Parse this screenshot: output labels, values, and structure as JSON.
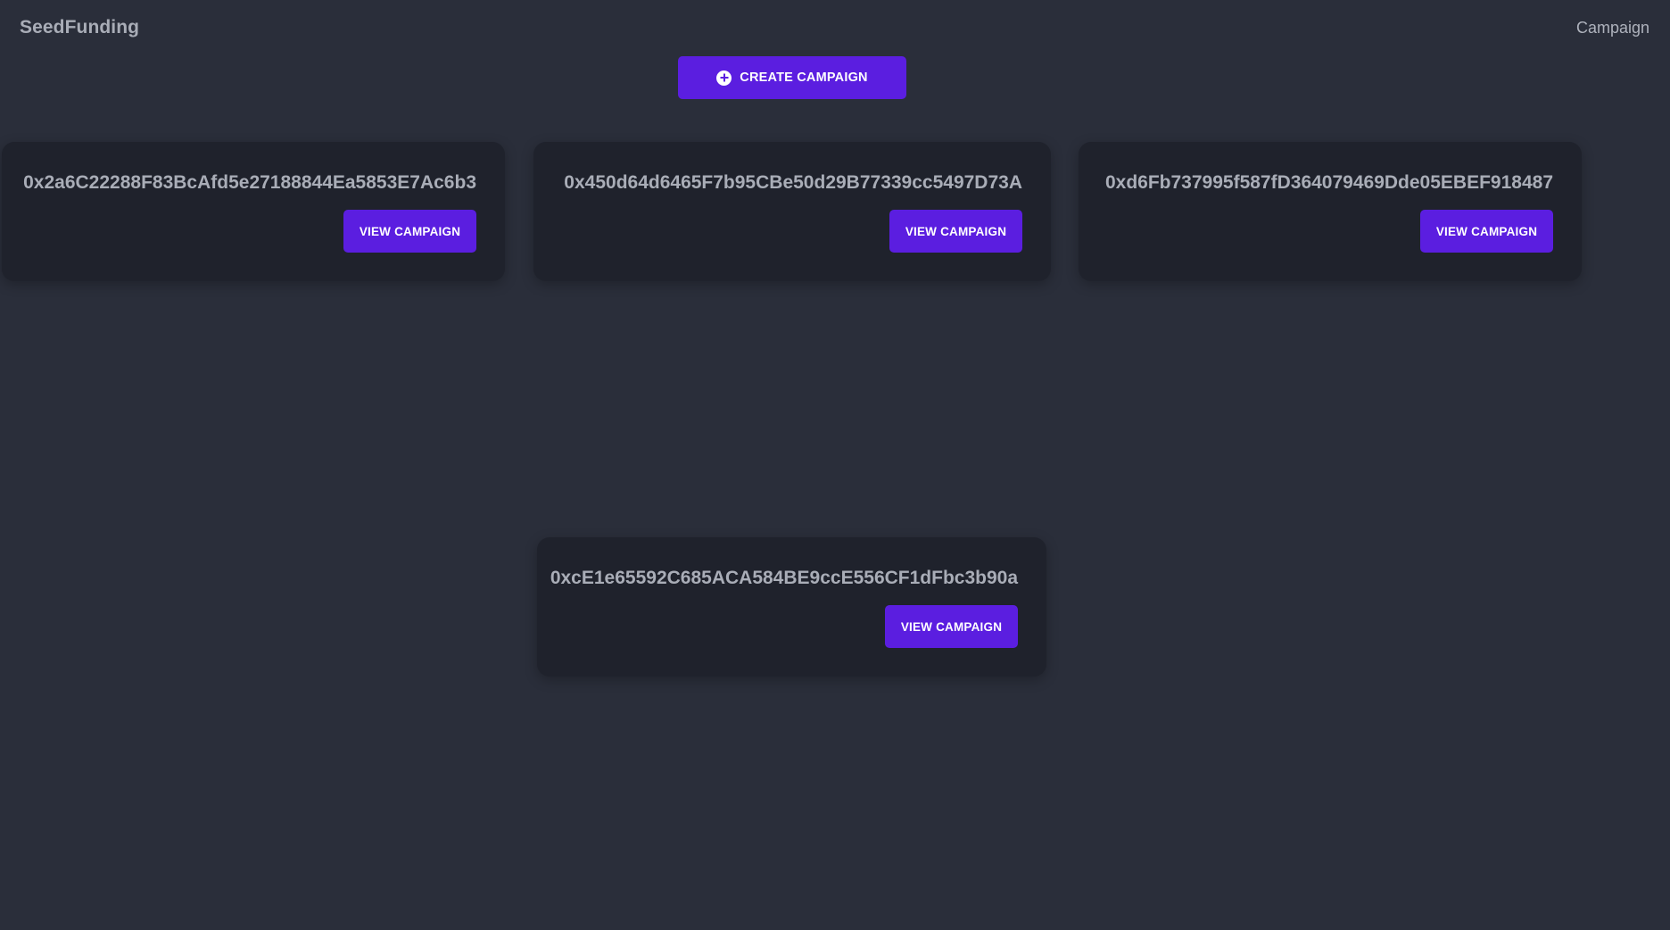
{
  "navbar": {
    "brand": "SeedFunding",
    "link": "Campaign"
  },
  "actions": {
    "create_label": "Create Campaign",
    "create_icon": "plus-circle-icon"
  },
  "colors": {
    "background": "#2a2e3a",
    "card": "#1f222c",
    "accent": "#5b1ee0",
    "text": "#a9adb7"
  },
  "campaigns": [
    {
      "address": "0x2a6C22288F83BcAfd5e27188844Ea5853E7Ac6b3",
      "button_label": "View Campaign"
    },
    {
      "address": "0x450d64d6465F7b95CBe50d29B77339cc5497D73A",
      "button_label": "View Campaign"
    },
    {
      "address": "0xd6Fb737995f587fD364079469Dde05EBEF918487",
      "button_label": "View Campaign"
    },
    {
      "address": "0xcE1e65592C685ACA584BE9ccE556CF1dFbc3b90a",
      "button_label": "View Campaign"
    }
  ]
}
